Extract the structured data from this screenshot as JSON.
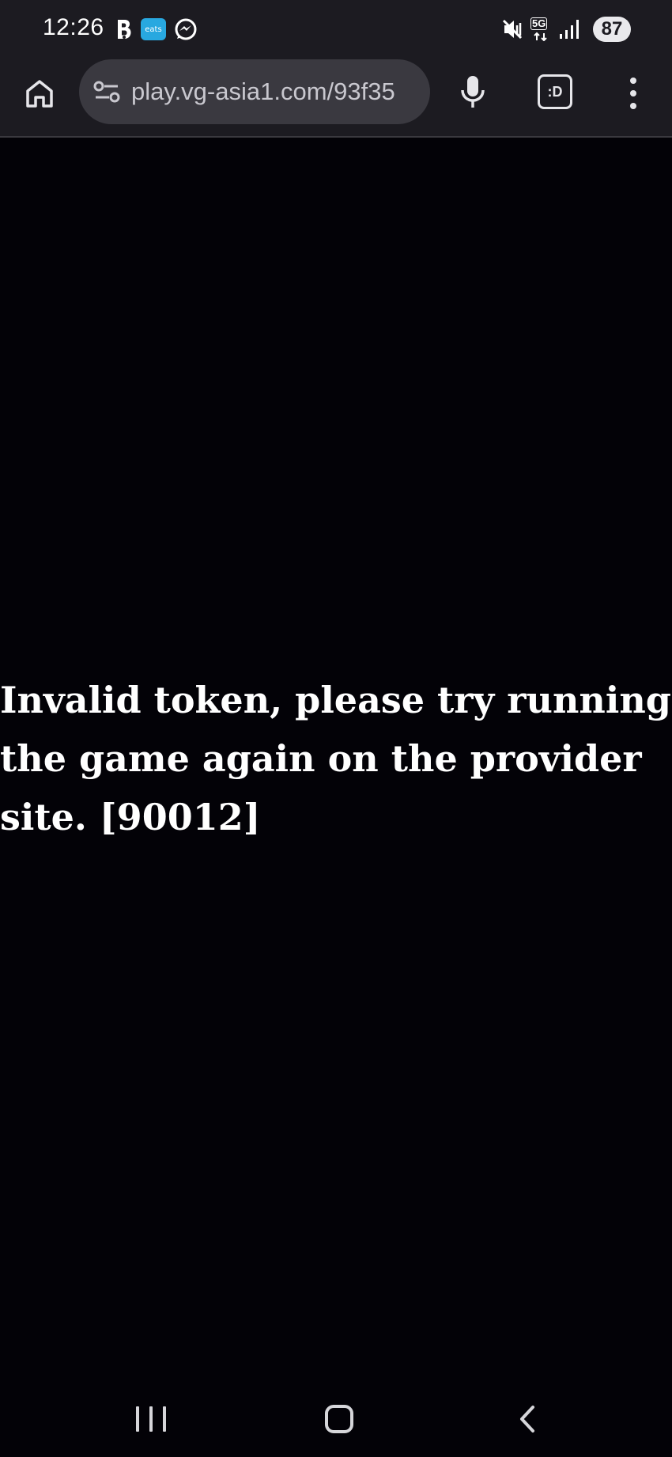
{
  "status_bar": {
    "time": "12:26",
    "notification_icons": [
      "bolt-app-icon",
      "eats-app-icon",
      "messenger-app-icon"
    ],
    "eats_label": "eats",
    "network_label": "5G",
    "status_icons": [
      "vibrate-mute-icon",
      "5g-data-icon",
      "signal-bars-icon"
    ],
    "battery": "87"
  },
  "browser": {
    "url": "play.vg-asia1.com/93f35",
    "tabs_button_label": ":D",
    "buttons": [
      "home-icon",
      "site-settings-icon",
      "mic-icon",
      "tabs-button",
      "overflow-menu-icon"
    ]
  },
  "page": {
    "error_message": "Invalid token, please try running the game again on the provider site. [90012]"
  },
  "colors": {
    "background": "#030207",
    "chrome": "#1c1b21",
    "url_bar": "#3a3940",
    "text": "#ffffff"
  }
}
